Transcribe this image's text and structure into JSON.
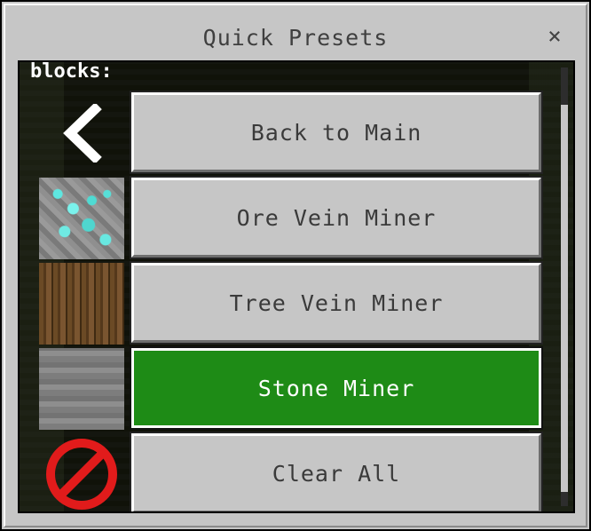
{
  "dialog": {
    "title": "Quick Presets",
    "close_label": "×"
  },
  "list": {
    "label": "blocks:",
    "items": [
      {
        "label": "Back to Main",
        "icon": "back-arrow-icon",
        "active": false
      },
      {
        "label": "Ore Vein Miner",
        "icon": "diamond-ore-icon",
        "active": false
      },
      {
        "label": "Tree Vein Miner",
        "icon": "oak-log-icon",
        "active": false
      },
      {
        "label": "Stone Miner",
        "icon": "stone-block-icon",
        "active": true
      },
      {
        "label": "Clear All",
        "icon": "no-entry-icon",
        "active": false
      }
    ]
  },
  "colors": {
    "panel": "#c6c6c6",
    "active_button": "#1e8b16",
    "no_entry_red": "#e11b1b"
  }
}
